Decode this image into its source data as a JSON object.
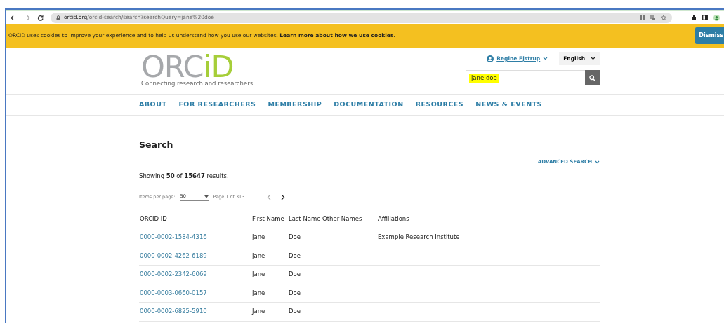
{
  "browser": {
    "url_host": "orcid.org",
    "url_path": "/orcid-search/search?searchQuery=jane%20doe"
  },
  "cookie_banner": {
    "text": "ORCID uses cookies to improve your experience and to help us understand how you use our websites. **Learn more about how we use cookies.**",
    "button": "Dismiss"
  },
  "header": {
    "logo_main": "ORC",
    "logo_accent": "iD",
    "tagline": "Connecting research and researchers",
    "user": "Regine Ejstrup",
    "language": "English",
    "search": {
      "value": "jane doe",
      "highlighted": true
    }
  },
  "nav": [
    "ABOUT",
    "FOR RESEARCHERS",
    "MEMBERSHIP",
    "DOCUMENTATION",
    "RESOURCES",
    "NEWS & EVENTS"
  ],
  "page": {
    "title": "Search",
    "advanced_search": "ADVANCED SEARCH",
    "summary": "Showing **50** of **15647** results.",
    "items_per_page_label": "Items per page:",
    "items_per_page": "50",
    "page_label": "Page 1 of 313",
    "prev_disabled": true,
    "next_disabled": false
  },
  "table": {
    "columns": [
      "ORCID ID",
      "First Name",
      "Last Name",
      "Other Names",
      "Affiliations"
    ],
    "rows": [
      {
        "orcid_id": "0000-0002-1584-4316",
        "first_name": "Jane",
        "last_name": "Doe",
        "affiliations": "Example Research Institute"
      },
      {
        "orcid_id": "0000-0002-4262-6189",
        "first_name": "Jane",
        "last_name": "Doe"
      },
      {
        "orcid_id": "0000-0002-2342-6069",
        "first_name": "Jane",
        "last_name": "Doe"
      },
      {
        "orcid_id": "0000-0003-0660-0157",
        "first_name": "Jane",
        "last_name": "Doe"
      },
      {
        "orcid_id": "0000-0002-6825-5910",
        "first_name": "Jane",
        "last_name": "Doe"
      }
    ]
  }
}
